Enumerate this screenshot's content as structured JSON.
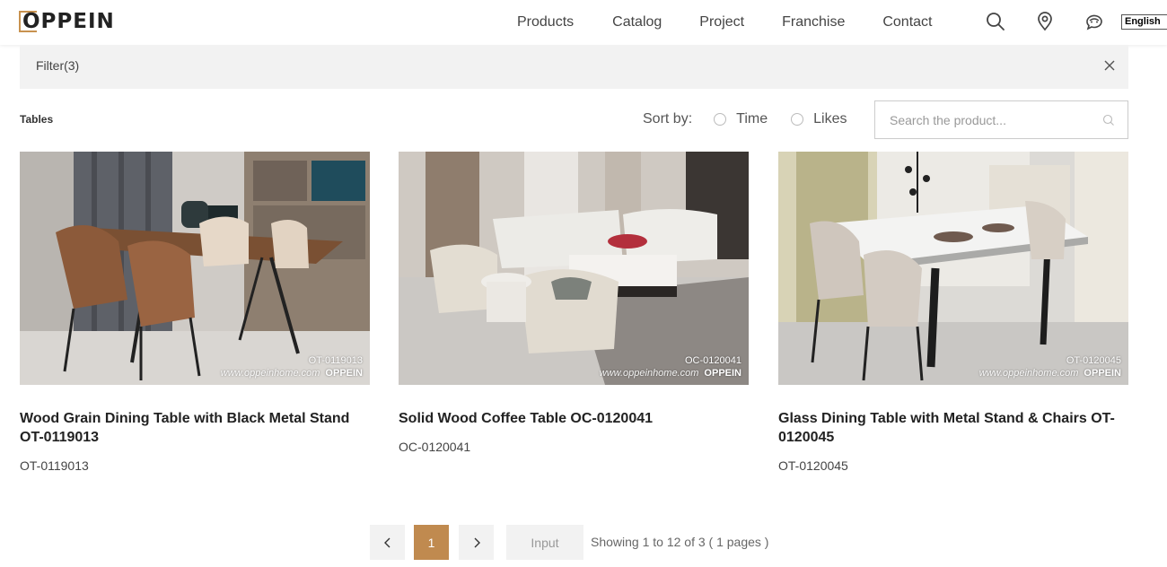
{
  "header": {
    "logo": "OPPEIN",
    "nav": [
      "Products",
      "Catalog",
      "Project",
      "Franchise",
      "Contact"
    ],
    "language": "English"
  },
  "filter": {
    "label": "Filter(3)"
  },
  "toolbar": {
    "section_title": "Tables",
    "sort_label": "Sort by:",
    "sort_options": [
      "Time",
      "Likes"
    ],
    "search_placeholder": "Search the product..."
  },
  "products": [
    {
      "title": "Wood Grain Dining Table with Black Metal Stand OT-0119013",
      "code": "OT-0119013",
      "watermark_code": "OT-0119013",
      "watermark_site": "www.oppeinhome.com",
      "watermark_brand": "OPPEIN"
    },
    {
      "title": "Solid Wood Coffee Table OC-0120041",
      "code": "OC-0120041",
      "watermark_code": "OC-0120041",
      "watermark_site": "www.oppeinhome.com",
      "watermark_brand": "OPPEIN"
    },
    {
      "title": "Glass Dining Table with Metal Stand & Chairs OT-0120045",
      "code": "OT-0120045",
      "watermark_code": "OT-0120045",
      "watermark_site": "www.oppeinhome.com",
      "watermark_brand": "OPPEIN"
    }
  ],
  "pagination": {
    "current_page": "1",
    "input_placeholder": "Input",
    "info": "Showing 1 to 12 of 3 ( 1 pages )"
  },
  "colors": {
    "accent": "#c08a4f",
    "filter_bg": "#f2f2f2"
  }
}
